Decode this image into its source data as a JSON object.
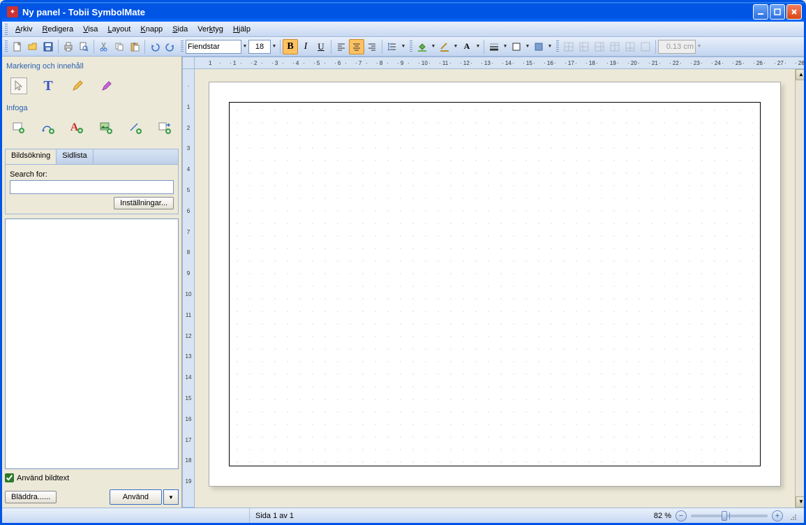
{
  "title": "Ny panel - Tobii SymbolMate",
  "menus": [
    "Arkiv",
    "Redigera",
    "Visa",
    "Layout",
    "Knapp",
    "Sida",
    "Verktyg",
    "Hjälp"
  ],
  "font": {
    "name": "Fiendstar",
    "size": "18"
  },
  "unit_box": "0.13 cm",
  "sidebar": {
    "section1": "Markering och innehåll",
    "section2": "Infoga",
    "tabs": [
      "Bildsökning",
      "Sidlista"
    ],
    "search_label": "Search for:",
    "settings_btn": "Inställningar...",
    "use_caption": "Använd bildtext",
    "browse_btn": "Bläddra......",
    "use_btn": "Använd"
  },
  "status": {
    "page": "Sida 1 av 1",
    "zoom": "82 %"
  },
  "hruler": [
    "1",
    "",
    "1",
    "",
    "2",
    "",
    "3",
    "",
    "4",
    "",
    "5",
    "",
    "6",
    "",
    "7",
    "",
    "8",
    "",
    "9",
    "",
    "10",
    "",
    "11",
    "",
    "12",
    "",
    "13",
    "",
    "14",
    "",
    "15",
    "",
    "16",
    "",
    "17",
    "",
    "18",
    "",
    "19",
    "",
    "20",
    "",
    "21",
    "",
    "22",
    "",
    "23",
    "",
    "24",
    "",
    "25",
    "",
    "26",
    "",
    "27",
    "",
    "28"
  ],
  "vruler": [
    "",
    "1",
    "2",
    "3",
    "4",
    "5",
    "6",
    "7",
    "8",
    "9",
    "10",
    "11",
    "12",
    "13",
    "14",
    "15",
    "16",
    "17",
    "18",
    "19"
  ]
}
